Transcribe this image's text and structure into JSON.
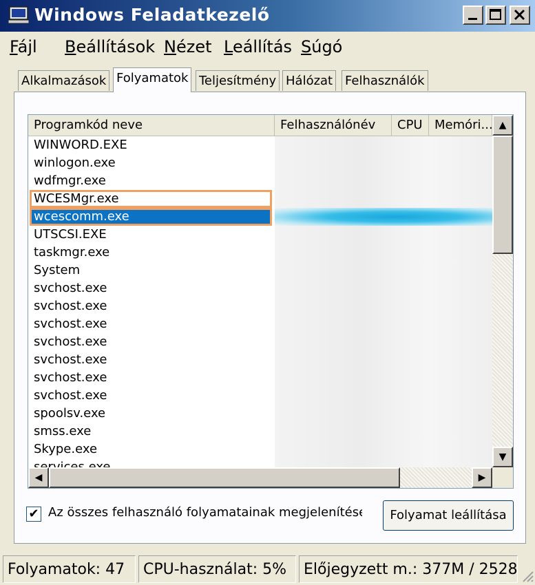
{
  "window": {
    "title": "Windows Feladatkezelő",
    "minimize_label": "_",
    "maximize_label": "□",
    "close_label": "X"
  },
  "menu": [
    {
      "label": "Fájl",
      "accel": "F"
    },
    {
      "label": "Beállítások",
      "accel": "B"
    },
    {
      "label": "Nézet",
      "accel": "N"
    },
    {
      "label": "Leállítás",
      "accel": "L"
    },
    {
      "label": "Súgó",
      "accel": "S"
    }
  ],
  "tabs": [
    {
      "label": "Alkalmazások",
      "active": false
    },
    {
      "label": "Folyamatok",
      "active": true
    },
    {
      "label": "Teljesítmény",
      "active": false
    },
    {
      "label": "Hálózat",
      "active": false
    },
    {
      "label": "Felhasználók",
      "active": false
    }
  ],
  "process_list": {
    "columns": [
      "Programkód neve",
      "Felhasználónév",
      "CPU",
      "Memóri..."
    ],
    "rows": [
      "WINWORD.EXE",
      "winlogon.exe",
      "wdfmgr.exe",
      "WCESMgr.exe",
      "wcescomm.exe",
      "UTSCSI.EXE",
      "taskmgr.exe",
      "System",
      "svchost.exe",
      "svchost.exe",
      "svchost.exe",
      "svchost.exe",
      "svchost.exe",
      "svchost.exe",
      "svchost.exe",
      "spoolsv.exe",
      "smss.exe",
      "Skype.exe",
      "services.exe"
    ],
    "highlighted_row": "WCESMgr.exe",
    "selected_row": "wcescomm.exe",
    "scroll_up_icon": "▲",
    "scroll_down_icon": "▼",
    "scroll_left_icon": "◀",
    "scroll_right_icon": "▶"
  },
  "show_all_users": {
    "checked": true,
    "check_mark": "✔",
    "label": "Az összes felhasználó folyamatainak megjelenítése"
  },
  "end_process_button": "Folyamat leállítása",
  "status_bar": {
    "processes": "Folyamatok: 47",
    "cpu": "CPU-használat: 5%",
    "commit": "Előjegyzett m.: 377M / 2528"
  },
  "colors": {
    "selection": "#0b72c4",
    "highlight_border": "#f0a060",
    "title_gradient_start": "#0a246a"
  }
}
